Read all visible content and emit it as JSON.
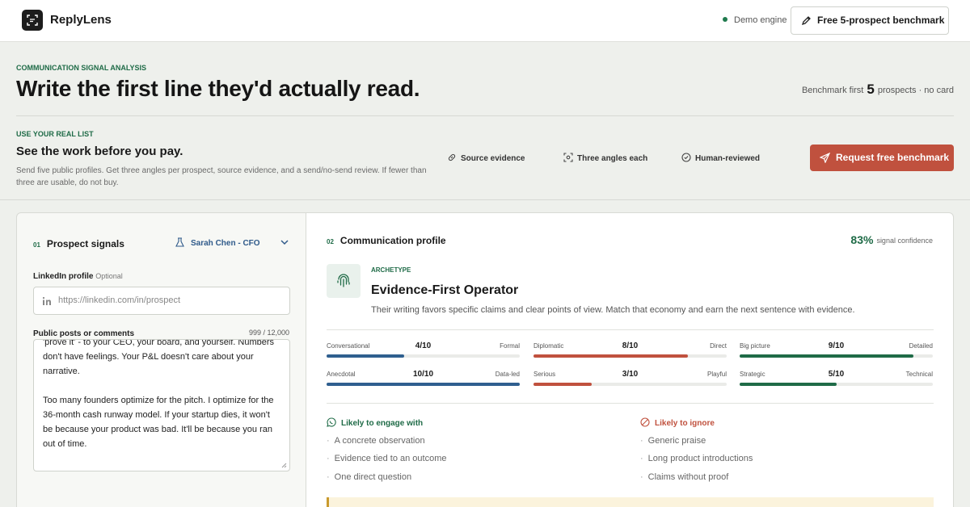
{
  "header": {
    "brand": "ReplyLens",
    "engine": "Demo engine",
    "cta": "Free 5-prospect benchmark"
  },
  "hero": {
    "kicker": "COMMUNICATION SIGNAL ANALYSIS",
    "title": "Write the first line they'd actually read.",
    "bench_pre": "Benchmark first",
    "bench_num": "5",
    "bench_post": "prospects · no card"
  },
  "offer": {
    "kicker": "USE YOUR REAL LIST",
    "title": "See the work before you pay.",
    "desc": "Send five public profiles. Get three angles per prospect, source evidence, and a send/no-send review. If fewer than three are usable, do not buy.",
    "features": [
      "Source evidence",
      "Three angles each",
      "Human-reviewed"
    ],
    "cta": "Request free benchmark"
  },
  "left": {
    "num": "01",
    "title": "Prospect signals",
    "prospect": "Sarah Chen - CFO",
    "linkedin_label": "LinkedIn profile",
    "optional": "Optional",
    "linkedin_placeholder": "https://linkedin.com/in/prospect",
    "posts_label": "Public posts or comments",
    "count": "999 / 12,000",
    "posts_text": "'prove it' - to your CEO, your board, and yourself. Numbers don't have feelings. Your P&L doesn't care about your narrative.\n\nToo many founders optimize for the pitch. I optimize for the 36-month cash runway model. If your startup dies, it won't be because your product was bad. It'll be because you ran out of time."
  },
  "right": {
    "num": "02",
    "title": "Communication profile",
    "confidence": "83%",
    "confidence_label": "signal confidence",
    "arch_kicker": "ARCHETYPE",
    "arch_title": "Evidence-First Operator",
    "arch_desc": "Their writing favors specific claims and clear points of view. Match that economy and earn the next sentence with evidence.",
    "scales": [
      {
        "left": "Conversational",
        "value": "4/10",
        "right": "Formal",
        "score": 0.4,
        "color": "#2f5f8f"
      },
      {
        "left": "Diplomatic",
        "value": "8/10",
        "right": "Direct",
        "score": 0.8,
        "color": "#c0513e"
      },
      {
        "left": "Big picture",
        "value": "9/10",
        "right": "Detailed",
        "score": 0.9,
        "color": "#1f6b47"
      },
      {
        "left": "Anecdotal",
        "value": "10/10",
        "right": "Data-led",
        "score": 1.0,
        "color": "#2f5f8f"
      },
      {
        "left": "Serious",
        "value": "3/10",
        "right": "Playful",
        "score": 0.3,
        "color": "#c0513e"
      },
      {
        "left": "Strategic",
        "value": "5/10",
        "right": "Technical",
        "score": 0.5,
        "color": "#1f6b47"
      }
    ],
    "engage_title": "Likely to engage with",
    "engage": [
      "A concrete observation",
      "Evidence tied to an outcome",
      "One direct question"
    ],
    "ignore_title": "Likely to ignore",
    "ignore": [
      "Generic praise",
      "Long product introductions",
      "Claims without proof"
    ]
  },
  "colors": {
    "green": "#1f6b47",
    "rust": "#c0513e",
    "blue": "#2f5f8f"
  }
}
